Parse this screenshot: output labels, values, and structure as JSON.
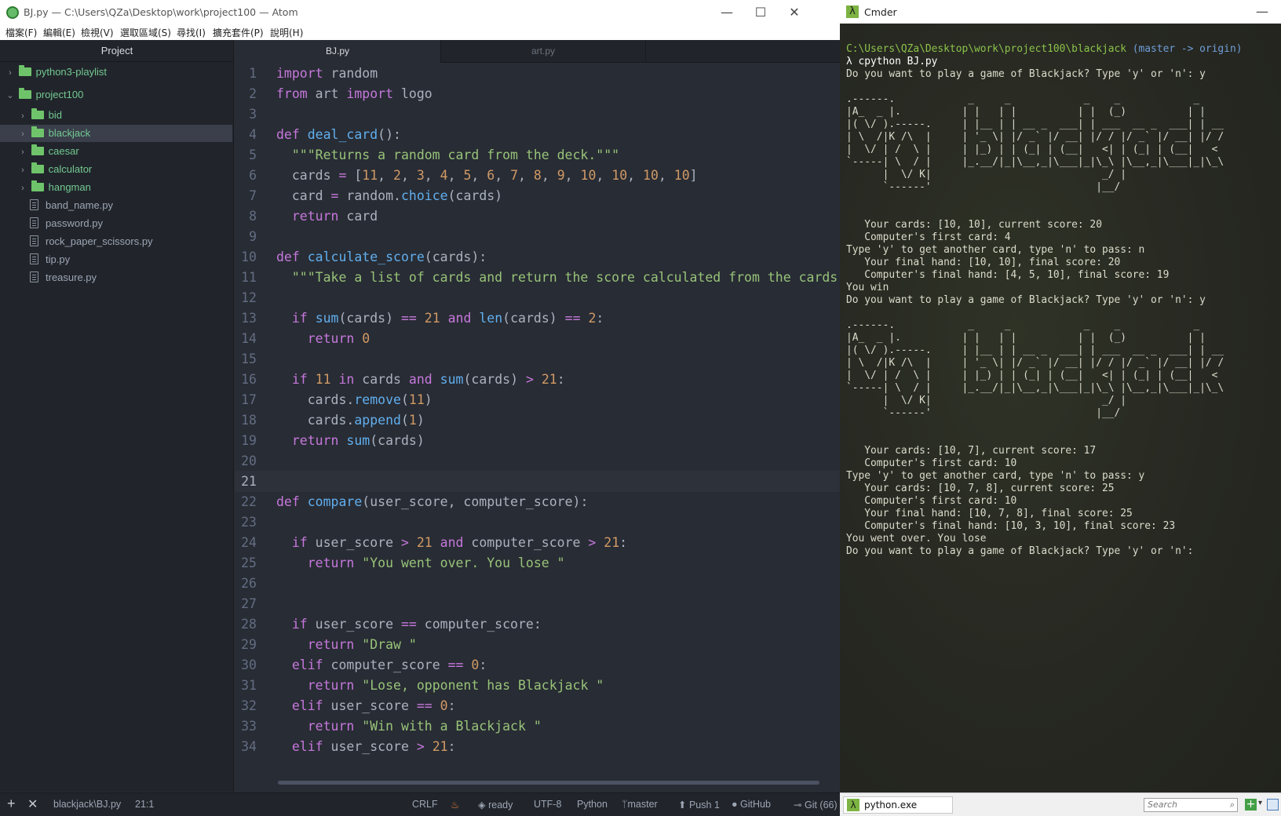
{
  "atom": {
    "title": "BJ.py — C:\\Users\\QZa\\Desktop\\work\\project100 — Atom",
    "window_controls": {
      "minimize": "—",
      "maximize": "☐",
      "close": "✕"
    },
    "menu": [
      "檔案(F)",
      "編輯(E)",
      "檢視(V)",
      "選取區域(S)",
      "尋找(I)",
      "擴充套件(P)",
      "說明(H)"
    ],
    "tree": {
      "header": "Project",
      "items": [
        {
          "label": "python3-playlist",
          "type": "folder",
          "chevron": "›"
        },
        {
          "label": "project100",
          "type": "folder",
          "chevron": "⌄"
        },
        {
          "label": "bid",
          "type": "folder",
          "chevron": "›"
        },
        {
          "label": "blackjack",
          "type": "folder",
          "chevron": "›"
        },
        {
          "label": "caesar",
          "type": "folder",
          "chevron": "›"
        },
        {
          "label": "calculator",
          "type": "folder",
          "chevron": "›"
        },
        {
          "label": "hangman",
          "type": "folder",
          "chevron": "›"
        },
        {
          "label": "band_name.py",
          "type": "file"
        },
        {
          "label": "password.py",
          "type": "file"
        },
        {
          "label": "rock_paper_scissors.py",
          "type": "file"
        },
        {
          "label": "tip.py",
          "type": "file"
        },
        {
          "label": "treasure.py",
          "type": "file"
        }
      ]
    },
    "tabs": [
      {
        "label": "BJ.py",
        "active": true
      },
      {
        "label": "art.py",
        "active": false
      }
    ],
    "editor": {
      "current_line": 21,
      "line_numbers": [
        "1",
        "2",
        "3",
        "4",
        "5",
        "6",
        "7",
        "8",
        "9",
        "10",
        "11",
        "12",
        "13",
        "14",
        "15",
        "16",
        "17",
        "18",
        "19",
        "20",
        "21",
        "22",
        "23",
        "24",
        "25",
        "26",
        "27",
        "28",
        "29",
        "30",
        "31",
        "32",
        "33",
        "34"
      ]
    },
    "status": {
      "path": "blackjack\\BJ.py",
      "cursor": "21:1",
      "line_ending": "CRLF",
      "ready": "ready",
      "encoding": "UTF-8",
      "grammar": "Python",
      "branch": "master",
      "push": "Push 1",
      "github": "GitHub",
      "git": "Git (66)"
    }
  },
  "cmder": {
    "title": "Cmder",
    "minimize": "—",
    "prompt_path": "C:\\Users\\QZa\\Desktop\\work\\project100\\blackjack",
    "prompt_branch": "(master -> origin)",
    "command": "λ cpython BJ.py",
    "output": [
      "Do you want to play a game of Blackjack? Type 'y' or 'n': y",
      "",
      ".------.            _     _            _    _            _",
      "|A_  _ |.          | |   | |          | |  (_)          | |",
      "|( \\/ ).-----.     | |__ | | __ _  ___| | ___  __ _  ___| | __",
      "| \\  /|K /\\  |     | '_ \\| |/ _` |/ __| |/ / |/ _` |/ __| |/ /",
      "|  \\/ | /  \\ |     | |_) | | (_| | (__|   <| | (_| | (__|   <",
      "`-----| \\  / |     |_.__/|_|\\__,_|\\___|_|\\_\\ |\\__,_|\\___|_|\\_\\",
      "      |  \\/ K|                            _/ |",
      "      `------'                           |__/",
      "",
      "",
      "   Your cards: [10, 10], current score: 20",
      "   Computer's first card: 4",
      "Type 'y' to get another card, type 'n' to pass: n",
      "   Your final hand: [10, 10], final score: 20",
      "   Computer's final hand: [4, 5, 10], final score: 19",
      "You win",
      "Do you want to play a game of Blackjack? Type 'y' or 'n': y",
      "",
      ".------.            _     _            _    _            _",
      "|A_  _ |.          | |   | |          | |  (_)          | |",
      "|( \\/ ).-----.     | |__ | | __ _  ___| | ___  __ _  ___| | __",
      "| \\  /|K /\\  |     | '_ \\| |/ _` |/ __| |/ / |/ _` |/ __| |/ /",
      "|  \\/ | /  \\ |     | |_) | | (_| | (__|   <| | (_| | (__|   <",
      "`-----| \\  / |     |_.__/|_|\\__,_|\\___|_|\\_\\ |\\__,_|\\___|_|\\_\\",
      "      |  \\/ K|                            _/ |",
      "      `------'                           |__/",
      "",
      "",
      "   Your cards: [10, 7], current score: 17",
      "   Computer's first card: 10",
      "Type 'y' to get another card, type 'n' to pass: y",
      "   Your cards: [10, 7, 8], current score: 25",
      "   Computer's first card: 10",
      "   Your final hand: [10, 7, 8], final score: 25",
      "   Computer's final hand: [10, 3, 10], final score: 23",
      "You went over. You lose",
      "Do you want to play a game of Blackjack? Type 'y' or 'n':"
    ],
    "taskbar": {
      "tab_label": "python.exe",
      "search_placeholder": "Search",
      "add": "+",
      "dropdown": "▾"
    }
  },
  "colors": {
    "editor_bg": "#282c34",
    "tree_bg": "#21252b",
    "keyword": "#c678dd",
    "function": "#61afef",
    "string": "#98c379",
    "number": "#d19a66",
    "console_bg": "#272822",
    "console_path": "#8bc34a"
  }
}
